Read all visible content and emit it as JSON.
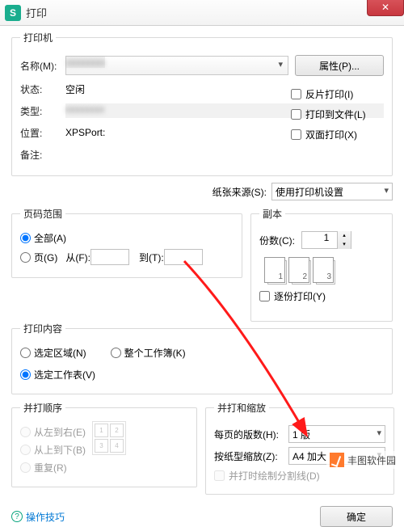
{
  "window": {
    "title": "打印",
    "app_icon": "S",
    "close_icon": "✕"
  },
  "printer": {
    "legend": "打印机",
    "name_label": "名称(M):",
    "name_value": "",
    "properties_btn": "属性(P)...",
    "status_label": "状态:",
    "status_value": "空闲",
    "type_label": "类型:",
    "type_value": "",
    "where_label": "位置:",
    "where_value": "XPSPort:",
    "comment_label": "备注:",
    "reverse": "反片打印(I)",
    "to_file": "打印到文件(L)",
    "duplex": "双面打印(X)",
    "source_label": "纸张来源(S):",
    "source_value": "使用打印机设置"
  },
  "range": {
    "legend": "页码范围",
    "all": "全部(A)",
    "pages": "页(G)",
    "from_label": "从(F):",
    "to_label": "到(T):"
  },
  "copies": {
    "legend": "副本",
    "count_label": "份数(C):",
    "count_value": "1",
    "collate": "逐份打印(Y)",
    "pages": [
      "1",
      "2",
      "3"
    ]
  },
  "content": {
    "legend": "打印内容",
    "selection": "选定区域(N)",
    "workbook": "整个工作簿(K)",
    "sheets": "选定工作表(V)"
  },
  "order": {
    "legend": "并打顺序",
    "lr": "从左到右(E)",
    "tb": "从上到下(B)",
    "repeat": "重复(R)",
    "cells": [
      "1",
      "2",
      "3",
      "4"
    ]
  },
  "scale": {
    "legend": "并打和缩放",
    "per_page_label": "每页的版数(H):",
    "per_page_value": "1 版",
    "scale_label": "按纸型缩放(Z):",
    "scale_value": "A4 加大",
    "draw_lines": "并打时绘制分割线(D)"
  },
  "footer": {
    "help": "操作技巧",
    "ok": "确定"
  },
  "watermark": "丰图软件园"
}
